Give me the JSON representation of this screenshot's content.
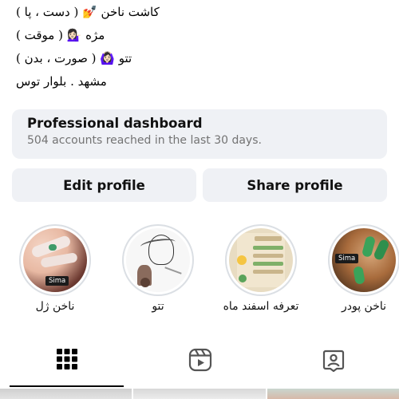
{
  "bio": {
    "lines": [
      "کاشت ناخن 💅 ( دست ، پا )",
      "مژه 💁🏻‍♀️ ( موقت )",
      "تتو 🙆🏻‍♀️ ( صورت ، بدن )",
      "مشهد . بلوار توس"
    ]
  },
  "dashboard": {
    "title": "Professional dashboard",
    "subtitle": "504 accounts reached in the last 30 days."
  },
  "actions": {
    "edit_label": "Edit profile",
    "share_label": "Share profile"
  },
  "highlights": [
    {
      "label": "ناخن ژل",
      "badge": "Sima"
    },
    {
      "label": "تتو",
      "badge": ""
    },
    {
      "label": "تعرفه اسفند ماه",
      "badge": ""
    },
    {
      "label": "ناخن پودر",
      "badge": "Sima"
    }
  ],
  "tabs": [
    {
      "icon": "grid-icon",
      "active": true
    },
    {
      "icon": "reels-icon",
      "active": false
    },
    {
      "icon": "tagged-icon",
      "active": false
    }
  ],
  "colors": {
    "card_bg": "#eff1f5",
    "secondary_text": "#737373",
    "ring": "#dbdfe4"
  }
}
